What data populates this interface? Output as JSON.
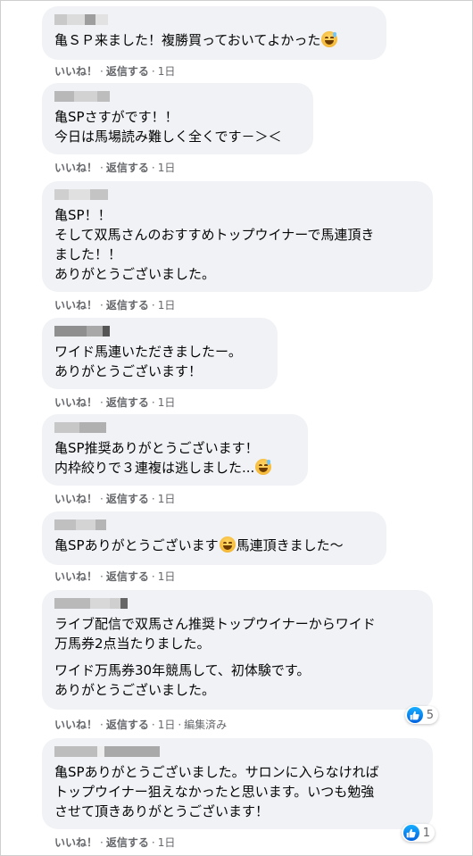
{
  "actions": {
    "like": "いいね！",
    "reply": "返信する",
    "dot": "·"
  },
  "comments": [
    {
      "lines": [
        "亀ＳＰ来ました！複勝買っておいてよかった"
      ],
      "time": "1日"
    },
    {
      "lines": [
        "亀SPさすがです！！\n今日は馬場読み難しく全くです－＞＜"
      ],
      "time": "1日"
    },
    {
      "lines": [
        "亀SP！！\nそして双馬さんのおすすめトップウイナーで馬連頂き\nました！！\nありがとうございました。"
      ],
      "time": "1日"
    },
    {
      "lines": [
        "ワイド馬連いただきましたー。\nありがとうございます！"
      ],
      "time": "1日"
    },
    {
      "lines": [
        "亀SP推奨ありがとうございます！\n内枠絞りで３連複は逃しました..."
      ],
      "time": "1日"
    },
    {
      "lines": [
        "亀SPありがとうございます",
        "馬連頂きました～"
      ],
      "time": "1日"
    },
    {
      "lines": [
        "ライブ配信で双馬さん推奨トップウイナーからワイド\n万馬券2点当たりました。",
        "ワイド万馬券30年競馬して、初体験です。\nありがとうございました。"
      ],
      "time": "1日",
      "edited": "編集済み",
      "reactions": "5"
    },
    {
      "lines": [
        "亀SPありがとうございました。サロンに入らなければ\nトップウイナー狙えなかったと思います。いつも勉強\nさせて頂きありがとうございます！"
      ],
      "time": "1日",
      "reactions": "1"
    }
  ],
  "emoji_icon": "grinning-sweat-face-icon",
  "reaction_icon": "thumbs-up-icon",
  "colors": {
    "bubble": "#f0f2f5",
    "meta": "#65676b",
    "like_blue": "#1877f2"
  }
}
